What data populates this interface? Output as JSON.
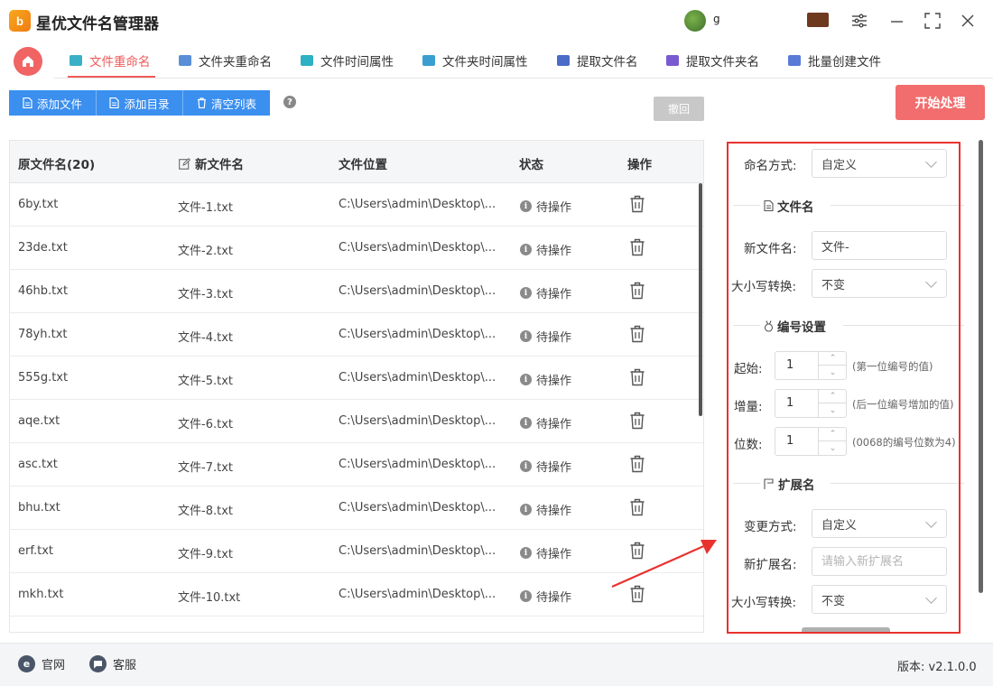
{
  "app": {
    "title": "星优文件名管理器",
    "logo_text": "b",
    "user_name": "g"
  },
  "tabs": [
    {
      "label": "文件重命名",
      "color": "#3ab0c8"
    },
    {
      "label": "文件夹重命名",
      "color": "#5a8fd8"
    },
    {
      "label": "文件时间属性",
      "color": "#2fb0c4"
    },
    {
      "label": "文件夹时间属性",
      "color": "#3a9fd0"
    },
    {
      "label": "提取文件名",
      "color": "#4a6cc8"
    },
    {
      "label": "提取文件夹名",
      "color": "#7a5ad0"
    },
    {
      "label": "批量创建文件",
      "color": "#5a7ad8"
    }
  ],
  "toolbar": {
    "add_file": "添加文件",
    "add_dir": "添加目录",
    "clear_list": "清空列表",
    "help": "?",
    "undo": "撤回",
    "start": "开始处理"
  },
  "table": {
    "headers": {
      "orig": "原文件名(20)",
      "new": "新文件名",
      "location": "文件位置",
      "status": "状态",
      "action": "操作"
    },
    "rows": [
      {
        "orig": "6by.txt",
        "new": "文件-1.txt",
        "location": "C:\\Users\\admin\\Desktop\\...",
        "status": "待操作"
      },
      {
        "orig": "23de.txt",
        "new": "文件-2.txt",
        "location": "C:\\Users\\admin\\Desktop\\...",
        "status": "待操作"
      },
      {
        "orig": "46hb.txt",
        "new": "文件-3.txt",
        "location": "C:\\Users\\admin\\Desktop\\...",
        "status": "待操作"
      },
      {
        "orig": "78yh.txt",
        "new": "文件-4.txt",
        "location": "C:\\Users\\admin\\Desktop\\...",
        "status": "待操作"
      },
      {
        "orig": "555g.txt",
        "new": "文件-5.txt",
        "location": "C:\\Users\\admin\\Desktop\\...",
        "status": "待操作"
      },
      {
        "orig": "aqe.txt",
        "new": "文件-6.txt",
        "location": "C:\\Users\\admin\\Desktop\\...",
        "status": "待操作"
      },
      {
        "orig": "asc.txt",
        "new": "文件-7.txt",
        "location": "C:\\Users\\admin\\Desktop\\...",
        "status": "待操作"
      },
      {
        "orig": "bhu.txt",
        "new": "文件-8.txt",
        "location": "C:\\Users\\admin\\Desktop\\...",
        "status": "待操作"
      },
      {
        "orig": "erf.txt",
        "new": "文件-9.txt",
        "location": "C:\\Users\\admin\\Desktop\\...",
        "status": "待操作"
      },
      {
        "orig": "mkh.txt",
        "new": "文件-10.txt",
        "location": "C:\\Users\\admin\\Desktop\\...",
        "status": "待操作"
      }
    ]
  },
  "panel": {
    "naming_method_label": "命名方式:",
    "naming_method_value": "自定义",
    "section_filename": "文件名",
    "new_filename_label": "新文件名:",
    "new_filename_value": "文件-",
    "case_label": "大小写转换:",
    "case_value": "不变",
    "section_numbering": "编号设置",
    "start_label": "起始:",
    "start_value": "1",
    "start_hint": "(第一位编号的值)",
    "increment_label": "增量:",
    "increment_value": "1",
    "increment_hint": "(后一位编号增加的值)",
    "digits_label": "位数:",
    "digits_value": "1",
    "digits_hint": "(0068的编号位数为4)",
    "section_extension": "扩展名",
    "change_method_label": "变更方式:",
    "change_method_value": "自定义",
    "new_ext_label": "新扩展名:",
    "new_ext_placeholder": "请输入新扩展名",
    "ext_case_label": "大小写转换:",
    "ext_case_value": "不变"
  },
  "footer": {
    "website": "官网",
    "support": "客服",
    "version": "版本:  v2.1.0.0"
  },
  "colors": {
    "accent": "#f05a5a",
    "primary_blue": "#3b8fef",
    "highlight_red": "#e8322e"
  }
}
